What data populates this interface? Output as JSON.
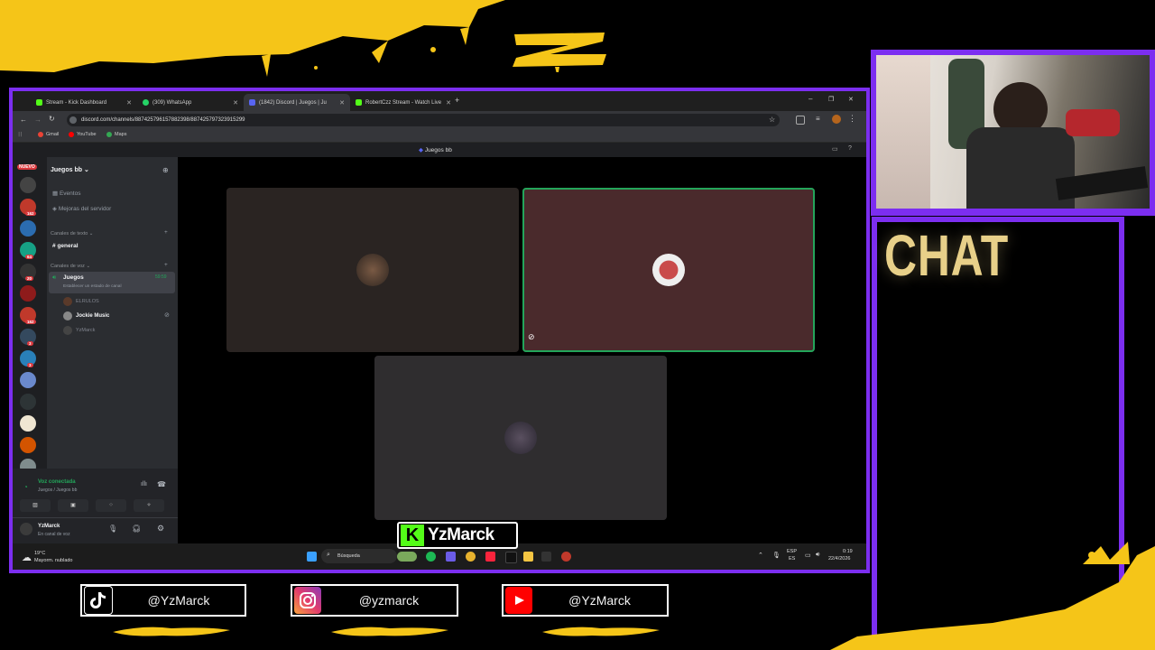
{
  "browser": {
    "tabs": [
      {
        "label": "Stream - Kick Dashboard",
        "color": "#53fc18"
      },
      {
        "label": "(309) WhatsApp",
        "color": "#25d366"
      },
      {
        "label": "(1842) Discord | Juegos | Ju",
        "color": "#5865f2"
      },
      {
        "label": "RobertCzz Stream - Watch Live",
        "color": "#53fc18"
      }
    ],
    "url": "discord.com/channels/887425796157882398/887425797323915299",
    "bookmarks": [
      "Gmail",
      "YouTube",
      "Maps"
    ]
  },
  "discord": {
    "title": "Juegos bb",
    "server_name": "Juegos bb",
    "guild_badges": [
      "NUEVO",
      "162",
      "64",
      "20",
      "162",
      "3",
      "3",
      "2"
    ],
    "menu": [
      "Eventos",
      "Mejoras del servidor"
    ],
    "text_category": "Canales de texto",
    "text_channel": "general",
    "voice_category": "Canales de voz",
    "voice_channel": "Juegos",
    "voice_timer": "59:59",
    "voice_status": "Establecer un estado de canal",
    "members": [
      "ELRULOS",
      "Jockie Music",
      "YzMarck"
    ],
    "connection_status": "Voz conectada",
    "connection_sub": "Juegos / Juegos bb",
    "user_name": "YzMarck",
    "user_status": "En canal de voz"
  },
  "taskbar": {
    "weather_temp": "19°C",
    "weather_desc": "Mayorm. nublado",
    "search": "Búsqueda",
    "lang_top": "ESP",
    "lang_bottom": "ES",
    "time": "0:19",
    "date": "22/4/2026"
  },
  "overlay": {
    "chat_title": "CHAT",
    "streamer_tag": "YzMarck",
    "kick_letter": "K",
    "socials": [
      {
        "platform": "tiktok-icon",
        "handle": "@YzMarck"
      },
      {
        "platform": "instagram-icon",
        "handle": "@yzmarck"
      },
      {
        "platform": "youtube-icon",
        "handle": "@YzMarck"
      }
    ],
    "colors": {
      "frame": "#7c2ef0",
      "paint": "#f5c518",
      "kick": "#53fc18"
    }
  }
}
